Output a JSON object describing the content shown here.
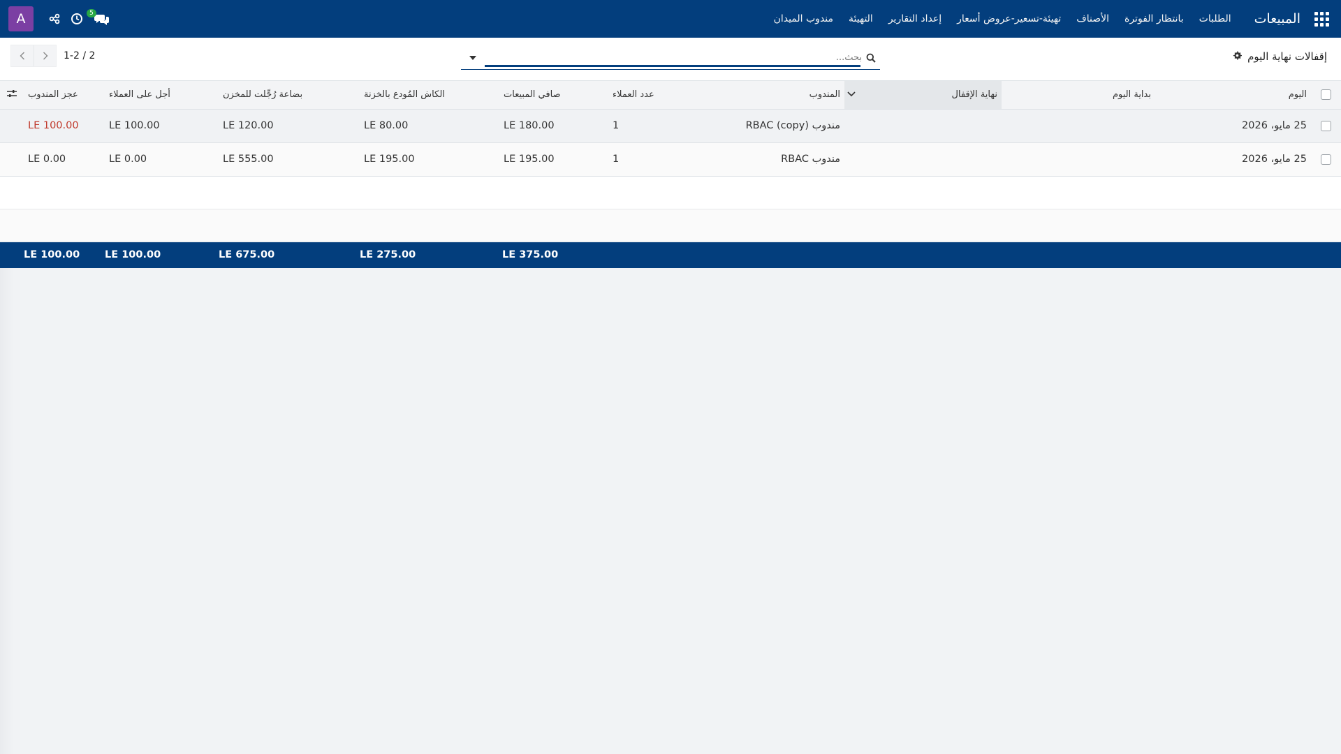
{
  "navbar": {
    "brand": "المبيعات",
    "menu": [
      "الطلبات",
      "بانتظار الفوترة",
      "الأصناف",
      "تهيئة-تسعير-عروض أسعار",
      "إعداد التقارير",
      "التهيئة",
      "مندوب الميدان"
    ],
    "chat_badge": "5",
    "avatar_letter": "A"
  },
  "control": {
    "title": "إقفالات نهاية اليوم",
    "search_placeholder": "بحث...",
    "pager_value": "1-2 / 2"
  },
  "table": {
    "headers": {
      "day": "اليوم",
      "day_start": "بداية اليوم",
      "closing_end": "نهاية الإقفال",
      "rep": "المندوب",
      "customers_count": "عدد العملاء",
      "net_sales": "صافي المبيعات",
      "cash_deposited": "الكاش المُودع بالخزنة",
      "goods_returned": "بضاعة رُجِّلت للمخزن",
      "customers_credit": "أجل على العملاء",
      "rep_deficit": "عجز المندوب"
    },
    "rows": [
      {
        "day": "25 مايو، 2026",
        "day_start": "",
        "closing_end": "",
        "rep": "مندوب RBAC (copy)",
        "customers_count": "1",
        "net_sales": "180.00 LE",
        "cash_deposited": "80.00 LE",
        "goods_returned": "120.00 LE",
        "customers_credit": "100.00 LE",
        "rep_deficit": "100.00 LE"
      },
      {
        "day": "25 مايو، 2026",
        "day_start": "",
        "closing_end": "",
        "rep": "مندوب RBAC",
        "customers_count": "1",
        "net_sales": "195.00 LE",
        "cash_deposited": "195.00 LE",
        "goods_returned": "555.00 LE",
        "customers_credit": "0.00 LE",
        "rep_deficit": "0.00 LE"
      }
    ],
    "totals": {
      "net_sales": "375.00 LE",
      "cash_deposited": "275.00 LE",
      "goods_returned": "675.00 LE",
      "customers_credit": "100.00 LE",
      "rep_deficit": "100.00 LE"
    }
  },
  "icons": {
    "apps": "apps-grid-icon",
    "gear": "gear-icon",
    "search": "search-icon",
    "search_toggle": "caret-down-icon",
    "pager_prev": "chevron-left-icon",
    "pager_next": "chevron-right-icon",
    "chat": "chat-icon",
    "clock": "clock-icon",
    "share": "share-icon",
    "sort": "chevron-down-icon",
    "col_settings": "sliders-icon"
  },
  "colors": {
    "navbar": "#033e7d",
    "avatar": "#7b3fa3",
    "badge": "#28a745",
    "danger": "#c0392b"
  }
}
